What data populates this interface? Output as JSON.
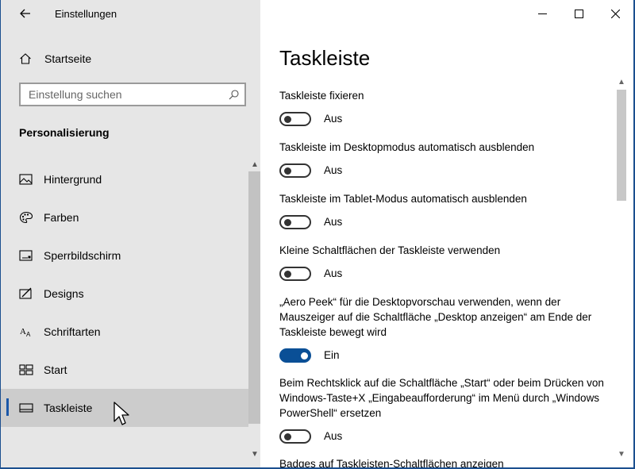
{
  "app": {
    "title": "Einstellungen"
  },
  "window_controls": {
    "minimize": "—",
    "maximize": "☐",
    "close": "✕"
  },
  "sidebar": {
    "home_label": "Startseite",
    "search": {
      "placeholder": "Einstellung suchen",
      "value": ""
    },
    "section_title": "Personalisierung",
    "items": [
      {
        "label": "Hintergrund",
        "icon": "image-icon"
      },
      {
        "label": "Farben",
        "icon": "palette-icon"
      },
      {
        "label": "Sperrbildschirm",
        "icon": "lock-screen-icon"
      },
      {
        "label": "Designs",
        "icon": "designs-icon"
      },
      {
        "label": "Schriftarten",
        "icon": "fonts-icon"
      },
      {
        "label": "Start",
        "icon": "start-icon"
      },
      {
        "label": "Taskleiste",
        "icon": "taskbar-icon",
        "selected": true
      }
    ]
  },
  "main": {
    "title": "Taskleiste",
    "settings": [
      {
        "label": "Taskleiste fixieren",
        "state": "Aus",
        "on": false
      },
      {
        "label": "Taskleiste im Desktopmodus automatisch ausblenden",
        "state": "Aus",
        "on": false
      },
      {
        "label": "Taskleiste im Tablet-Modus automatisch ausblenden",
        "state": "Aus",
        "on": false
      },
      {
        "label": "Kleine Schaltflächen der Taskleiste verwenden",
        "state": "Aus",
        "on": false
      },
      {
        "label": "„Aero Peek“ für die Desktopvorschau verwenden, wenn der Mauszeiger auf die Schaltfläche „Desktop anzeigen“ am Ende der Taskleiste bewegt wird",
        "state": "Ein",
        "on": true
      },
      {
        "label": "Beim Rechtsklick auf die Schaltfläche „Start“ oder beim Drücken von Windows-Taste+X „Eingabeaufforderung“ im Menü durch „Windows PowerShell“ ersetzen",
        "state": "Aus",
        "on": false
      },
      {
        "label": "Badges auf Taskleisten-Schaltflächen anzeigen"
      }
    ]
  }
}
